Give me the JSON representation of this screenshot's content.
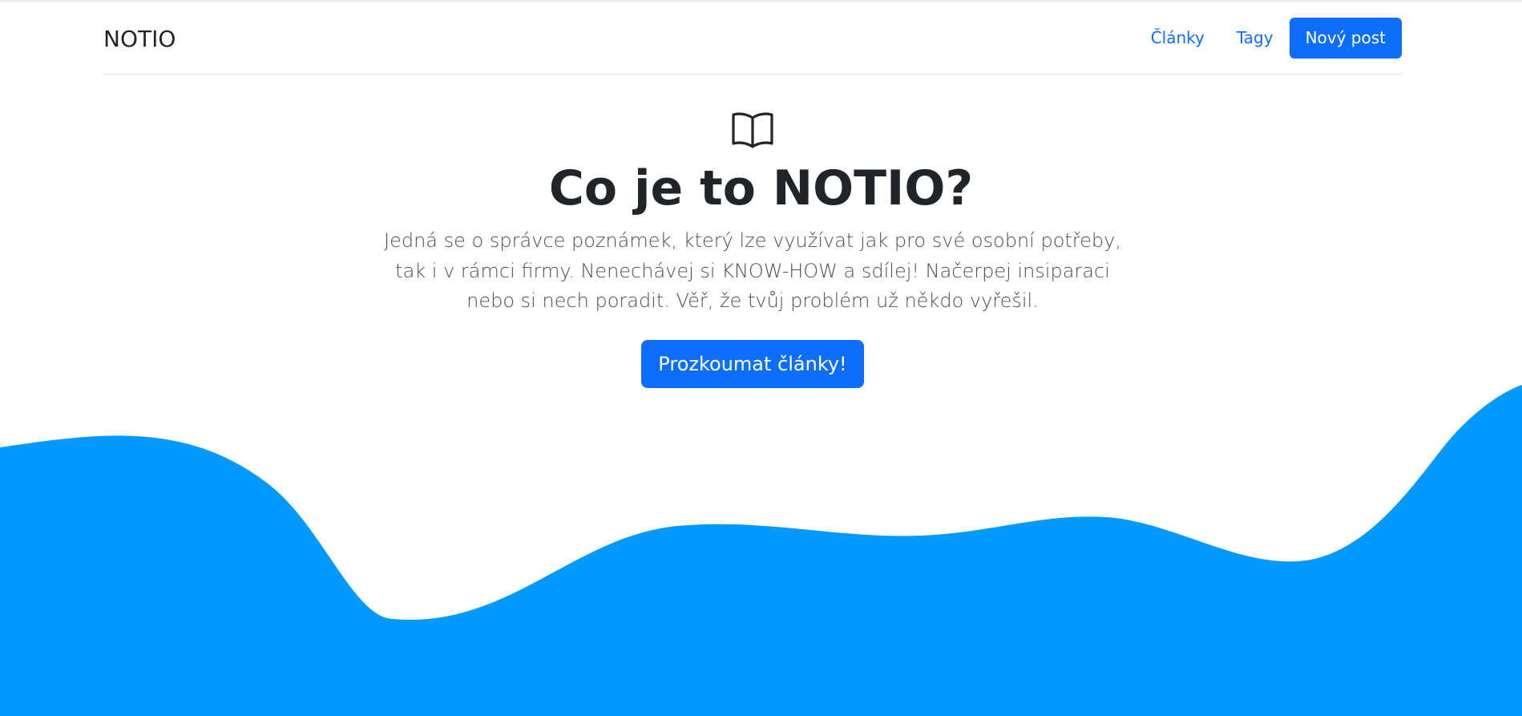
{
  "colors": {
    "primary": "#0d6efd",
    "wave": "#0099ff",
    "text": "#212529"
  },
  "navbar": {
    "brand": "NOTIO",
    "links": [
      {
        "label": "Články"
      },
      {
        "label": "Tagy"
      }
    ],
    "new_post_label": "Nový post"
  },
  "hero": {
    "icon": "book-icon",
    "title": "Co je to NOTIO?",
    "lead": "Jedná se o správce poznámek, který lze využívat jak pro své osobní potřeby, tak i v rámci firmy. Nenechávej si KNOW-HOW a sdílej! Načerpej insiparaci nebo si nech poradit. Věř, že tvůj problém už někdo vyřešil.",
    "button_label": "Prozkoumat články!"
  }
}
